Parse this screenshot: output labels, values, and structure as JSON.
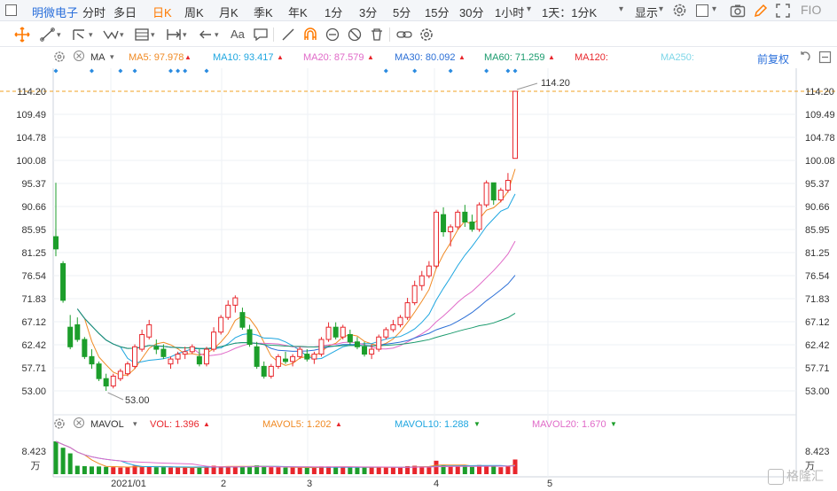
{
  "topbar": {
    "stock_name": "明微电子",
    "tabs": [
      "分时",
      "多日",
      "日K",
      "周K",
      "月K",
      "季K",
      "年K",
      "1分",
      "3分",
      "5分",
      "15分",
      "30分",
      "1小时",
      "1天：1分K"
    ],
    "active_tab": "日K",
    "display_label": "显示",
    "fio_label": "FIO"
  },
  "ma_legend": {
    "label": "MA",
    "ma5": "MA5: 97.978",
    "ma10": "MA10: 93.417",
    "ma20": "MA20: 87.579",
    "ma30": "MA30: 80.092",
    "ma60": "MA60: 71.259",
    "ma120": "MA120:",
    "ma250": "MA250:",
    "adjust": "前复权"
  },
  "vol_legend": {
    "label": "MAVOL",
    "vol": "VOL: 1.396",
    "mavol5": "MAVOL5: 1.202",
    "mavol10": "MAVOL10: 1.288",
    "mavol20": "MAVOL20: 1.670"
  },
  "price_axis": {
    "ticks": [
      "114.20",
      "109.49",
      "104.78",
      "100.08",
      "95.37",
      "90.66",
      "85.95",
      "81.25",
      "76.54",
      "71.83",
      "67.12",
      "62.42",
      "57.71",
      "53.00"
    ],
    "current_price": "114.20",
    "high_annotation": "114.20",
    "low_annotation": "53.00"
  },
  "volume_axis": {
    "top": "8.423",
    "unit": "万"
  },
  "time_axis": {
    "labels": [
      "2021/01",
      "2",
      "3",
      "4",
      "5"
    ]
  },
  "watermark": "格隆汇",
  "colors": {
    "up": "#e8262c",
    "down": "#1c9e2b",
    "ma5": "#f08a24",
    "ma10": "#1ea6e0",
    "ma20": "#e06ac8",
    "ma30": "#2b6fd6",
    "ma60": "#1b9b6e",
    "accent": "#ff7a00"
  },
  "chart_data": {
    "type": "candlestick",
    "title": "",
    "ylim": [
      53.0,
      114.2
    ],
    "ohlc": [
      [
        84.5,
        95.5,
        80.5,
        82.0
      ],
      [
        79.0,
        79.5,
        71.0,
        71.5
      ],
      [
        66.0,
        68.5,
        61.5,
        62.0
      ],
      [
        66.5,
        68.0,
        63.0,
        63.5
      ],
      [
        63.5,
        64.0,
        59.5,
        60.0
      ],
      [
        60.0,
        61.5,
        57.5,
        58.5
      ],
      [
        58.5,
        59.0,
        55.0,
        55.5
      ],
      [
        55.5,
        56.5,
        53.0,
        54.0
      ],
      [
        54.0,
        56.5,
        53.5,
        56.0
      ],
      [
        55.5,
        57.5,
        55.0,
        57.0
      ],
      [
        56.5,
        59.0,
        56.0,
        58.5
      ],
      [
        58.0,
        62.5,
        57.5,
        62.0
      ],
      [
        61.5,
        65.5,
        61.0,
        64.5
      ],
      [
        64.0,
        67.5,
        63.5,
        66.5
      ],
      [
        62.0,
        63.5,
        60.5,
        61.5
      ],
      [
        61.5,
        62.5,
        59.5,
        60.0
      ],
      [
        58.5,
        60.0,
        57.5,
        59.5
      ],
      [
        59.5,
        61.0,
        58.5,
        60.5
      ],
      [
        60.5,
        62.0,
        59.5,
        61.0
      ],
      [
        61.0,
        62.5,
        60.5,
        62.0
      ],
      [
        60.0,
        61.5,
        58.0,
        58.5
      ],
      [
        58.5,
        62.0,
        58.0,
        61.5
      ],
      [
        61.5,
        66.0,
        61.0,
        65.0
      ],
      [
        65.0,
        68.5,
        64.5,
        68.0
      ],
      [
        68.0,
        71.5,
        67.5,
        70.5
      ],
      [
        70.5,
        72.5,
        69.0,
        72.0
      ],
      [
        69.0,
        70.0,
        65.5,
        66.0
      ],
      [
        65.5,
        66.5,
        62.0,
        62.5
      ],
      [
        62.0,
        63.0,
        57.5,
        58.0
      ],
      [
        58.0,
        59.0,
        55.5,
        56.0
      ],
      [
        56.0,
        58.5,
        55.5,
        58.0
      ],
      [
        58.0,
        60.5,
        57.5,
        60.0
      ],
      [
        59.5,
        61.0,
        58.5,
        59.0
      ],
      [
        59.0,
        60.5,
        58.0,
        60.0
      ],
      [
        60.0,
        62.0,
        59.5,
        61.5
      ],
      [
        60.5,
        61.5,
        59.0,
        59.5
      ],
      [
        59.5,
        61.0,
        58.5,
        60.5
      ],
      [
        60.5,
        64.0,
        60.0,
        63.5
      ],
      [
        63.5,
        67.0,
        63.0,
        66.0
      ],
      [
        66.0,
        67.0,
        63.5,
        64.0
      ],
      [
        64.0,
        66.5,
        63.5,
        66.0
      ],
      [
        64.5,
        65.5,
        62.5,
        63.0
      ],
      [
        63.0,
        64.0,
        61.5,
        62.0
      ],
      [
        62.0,
        63.0,
        60.0,
        60.5
      ],
      [
        60.5,
        62.5,
        59.5,
        61.5
      ],
      [
        61.5,
        64.5,
        61.0,
        64.0
      ],
      [
        64.0,
        66.0,
        63.5,
        65.5
      ],
      [
        65.5,
        67.5,
        65.0,
        66.5
      ],
      [
        66.5,
        68.5,
        66.0,
        68.0
      ],
      [
        68.0,
        72.0,
        67.5,
        71.0
      ],
      [
        71.0,
        75.5,
        70.5,
        74.5
      ],
      [
        74.5,
        77.5,
        73.5,
        76.5
      ],
      [
        76.5,
        79.5,
        76.0,
        78.5
      ],
      [
        78.5,
        90.0,
        78.0,
        89.5
      ],
      [
        89.0,
        90.5,
        84.5,
        85.5
      ],
      [
        85.5,
        87.0,
        82.5,
        86.5
      ],
      [
        86.5,
        90.0,
        86.0,
        89.5
      ],
      [
        89.5,
        91.0,
        86.5,
        87.5
      ],
      [
        87.5,
        89.0,
        85.5,
        86.0
      ],
      [
        86.0,
        91.5,
        85.5,
        91.0
      ],
      [
        91.0,
        96.0,
        90.5,
        95.5
      ],
      [
        95.5,
        95.5,
        91.0,
        92.0
      ],
      [
        92.0,
        94.5,
        91.5,
        94.0
      ],
      [
        94.0,
        97.5,
        93.5,
        96.0
      ],
      [
        100.5,
        114.2,
        100.5,
        114.2
      ]
    ],
    "volume_ylim": [
      0,
      8.423
    ],
    "volume_unit": "万",
    "ma_lines": [
      "MA5",
      "MA10",
      "MA20",
      "MA30",
      "MA60"
    ]
  }
}
